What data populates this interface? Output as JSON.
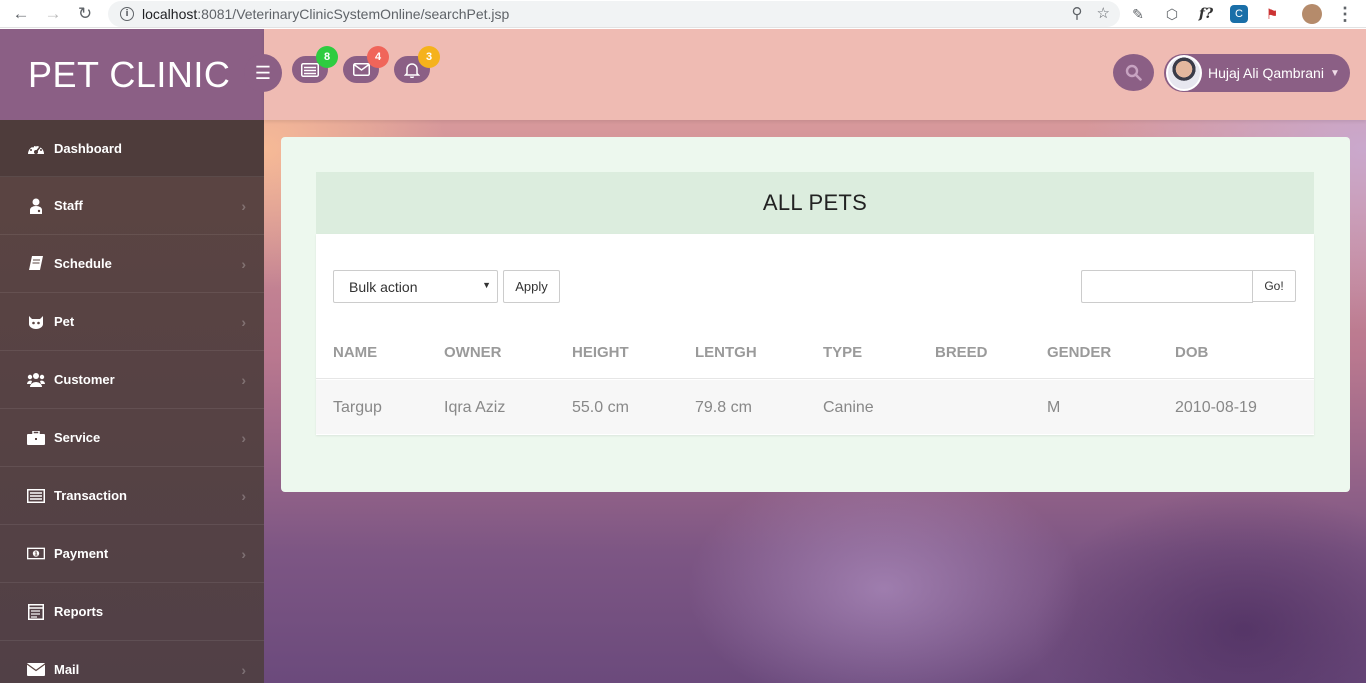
{
  "browser": {
    "url_host": "localhost",
    "url_rest": ":8081/VeterinaryClinicSystemOnline/searchPet.jsp"
  },
  "brand": {
    "title": "PET CLINIC"
  },
  "sidebar": {
    "items": [
      {
        "label": "Dashboard",
        "icon": "dashboard-icon"
      },
      {
        "label": "Staff",
        "icon": "user-doctor-icon"
      },
      {
        "label": "Schedule",
        "icon": "book-icon"
      },
      {
        "label": "Pet",
        "icon": "cat-icon"
      },
      {
        "label": "Customer",
        "icon": "users-icon"
      },
      {
        "label": "Service",
        "icon": "briefcase-icon"
      },
      {
        "label": "Transaction",
        "icon": "list-icon"
      },
      {
        "label": "Payment",
        "icon": "money-icon"
      },
      {
        "label": "Reports",
        "icon": "report-icon"
      },
      {
        "label": "Mail",
        "icon": "envelope-icon"
      }
    ]
  },
  "topbar": {
    "notifications": [
      {
        "icon": "tasks-icon",
        "count": "8",
        "color": "#2ecc40"
      },
      {
        "icon": "envelope-icon",
        "count": "4",
        "color": "#f0655a"
      },
      {
        "icon": "bell-icon",
        "count": "3",
        "color": "#f5b21c"
      }
    ],
    "user_name": "Hujaj Ali Qambrani"
  },
  "main": {
    "title": "ALL PETS",
    "bulk_action": "Bulk action",
    "apply_label": "Apply",
    "search_placeholder": "",
    "go_label": "Go!",
    "columns": [
      "NAME",
      "OWNER",
      "HEIGHT",
      "LENTGH",
      "TYPE",
      "BREED",
      "GENDER",
      "DOB"
    ],
    "rows": [
      [
        "Targup",
        "Iqra Aziz",
        "55.0 cm",
        "79.8 cm",
        "Canine",
        "",
        "M",
        "2010-08-19"
      ]
    ]
  },
  "colors": {
    "brand_purple": "#8b5f85",
    "topbar_pink": "#efbbb3",
    "card_green": "#edf8ee"
  }
}
